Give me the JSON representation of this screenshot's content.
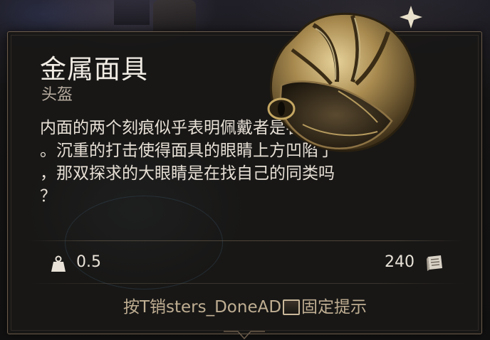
{
  "item": {
    "name": "金属面具",
    "type": "头盔",
    "description": "内面的两个刻痕似乎表明佩戴者是名军官\n。沉重的打击使得面具的眼睛上方凹陷了\n，那双探求的大眼睛是在找自己的同类吗\n？",
    "weight": "0.5",
    "price": "240"
  },
  "hint": {
    "prefix": "按T销sters_DoneAD",
    "suffix": "固定提示"
  },
  "icons": {
    "weight": "weight-icon",
    "price": "gold-coin-icon",
    "item_image": "metal-mask-icon"
  },
  "colors": {
    "panel_border": "#6b5c4c",
    "title": "#f1ece4",
    "subtitle": "#b8ada0",
    "hint": "#bfae92",
    "mask_gold": "#b59a5e"
  }
}
